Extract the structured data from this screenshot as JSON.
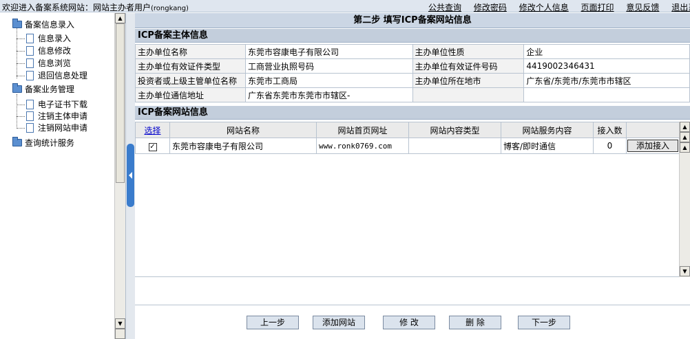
{
  "topbar": {
    "welcome": "欢迎进入备案系统网站：网站主办者用户",
    "username": "(rongkang)",
    "links": [
      "公共查询",
      "修改密码",
      "修改个人信息",
      "页面打印",
      "意见反馈",
      "退出系统"
    ]
  },
  "nav": {
    "group1": "备案信息录入",
    "group1_items": [
      "信息录入",
      "信息修改",
      "信息浏览",
      "退回信息处理"
    ],
    "group2": "备案业务管理",
    "group2_items": [
      "电子证书下载",
      "注销主体申请",
      "注销网站申请"
    ],
    "group3": "查询统计服务"
  },
  "main": {
    "step_title": "第二步  填写ICP备案网站信息",
    "subject_header": "ICP备案主体信息",
    "subject": {
      "r1": {
        "l1": "主办单位名称",
        "v1": "东莞市容康电子有限公司",
        "l2": "主办单位性质",
        "v2": "企业"
      },
      "r2": {
        "l1": "主办单位有效证件类型",
        "v1": "工商营业执照号码",
        "l2": "主办单位有效证件号码",
        "v2": "4419002346431"
      },
      "r3": {
        "l1": "投资者或上级主管单位名称",
        "v1": "东莞市工商局",
        "l2": "主办单位所在地市",
        "v2": "广东省/东莞市/东莞市市辖区"
      },
      "r4": {
        "l1": "主办单位通信地址",
        "v1": "广东省东莞市东莞市市辖区-",
        "l2": "",
        "v2": ""
      }
    },
    "sites_header": "ICP备案网站信息",
    "columns": {
      "select": "选择",
      "name": "网站名称",
      "url": "网站首页网址",
      "content_type": "网站内容类型",
      "service": "网站服务内容",
      "access_count": "接入数",
      "action": ""
    },
    "row": {
      "checked": "✓",
      "name": "东莞市容康电子有限公司",
      "url": "www.ronk0769.com",
      "content_type": "",
      "service": "博客/即时通信",
      "access_count": "0",
      "action": "添加接入"
    },
    "buttons": {
      "prev": "上一步",
      "add_site": "添加网站",
      "modify": "修  改",
      "delete": "删  除",
      "next": "下一步"
    }
  }
}
